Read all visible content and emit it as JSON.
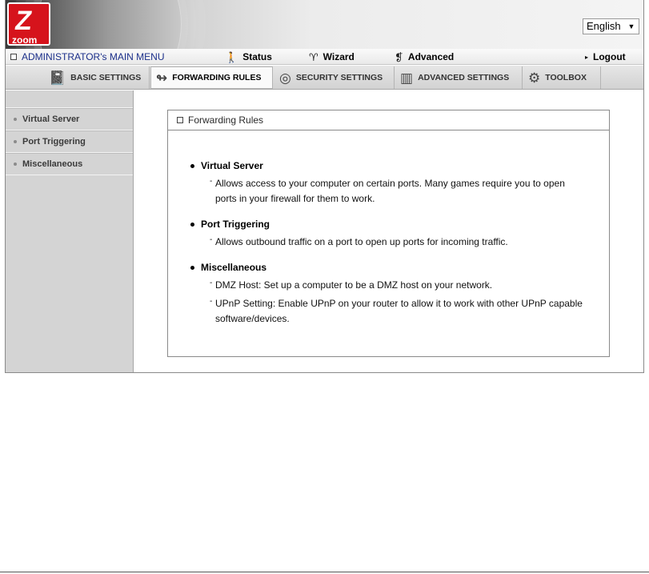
{
  "header": {
    "logo_text": "zoom",
    "language": "English"
  },
  "menubar": {
    "title": "ADMINISTRATOR's MAIN MENU",
    "status": "Status",
    "wizard": "Wizard",
    "advanced": "Advanced",
    "logout": "Logout"
  },
  "tabs": [
    {
      "label": "BASIC SETTINGS",
      "icon": "notebook-icon"
    },
    {
      "label": "FORWARDING RULES",
      "icon": "forwarding-arrow-icon"
    },
    {
      "label": "SECURITY SETTINGS",
      "icon": "security-ring-icon"
    },
    {
      "label": "ADVANCED SETTINGS",
      "icon": "advanced-book-icon"
    },
    {
      "label": "TOOLBOX",
      "icon": "toolbox-icon"
    }
  ],
  "sidebar": {
    "items": [
      {
        "label": "Virtual Server"
      },
      {
        "label": "Port Triggering"
      },
      {
        "label": "Miscellaneous"
      }
    ]
  },
  "content": {
    "title": "Forwarding Rules",
    "sections": [
      {
        "title": "Virtual Server",
        "lines": [
          "Allows access to your computer on certain ports. Many games require you to open ports in your firewall for them to work."
        ]
      },
      {
        "title": "Port Triggering",
        "lines": [
          "Allows outbound traffic on a port to open up ports for incoming traffic."
        ]
      },
      {
        "title": "Miscellaneous",
        "lines": [
          "DMZ Host: Set up a computer to be a DMZ host on your network.",
          "UPnP Setting: Enable UPnP on your router to allow it to work with other UPnP capable software/devices."
        ]
      }
    ]
  },
  "colors": {
    "title_blue": "#1b2f8a",
    "logo_red": "#d6131c",
    "sidebar_gray": "#d4d4d4"
  }
}
